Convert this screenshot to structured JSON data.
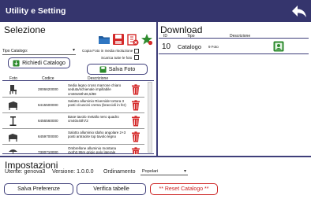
{
  "header": {
    "title": "Utility e Setting",
    "back_icon": "back-arrow-icon"
  },
  "colors": {
    "header_bg": "#35356d",
    "accent": "#3e3e7a",
    "danger": "#cc2222",
    "success": "#2e8b2e"
  },
  "selezione": {
    "title": "Selezione",
    "toolbar_icons": [
      "folder-icon",
      "save-icon",
      "delete-icon",
      "star-icon"
    ],
    "catalog_select": {
      "value": "Tipo Catalogo:"
    },
    "richiedi_label": "Richiedi Catalogo",
    "copia_label": "Copia Foto in media risoluzione",
    "scarica_label": "Scarica tutte le foto",
    "salva_foto_label": "Salva Foto",
    "table": {
      "columns": [
        "Foto",
        "Codice",
        "Descrizione"
      ],
      "rows": [
        {
          "code": "2806620000",
          "description": "Sedia legno cross marrone chiaro seduta/schienale impillabile cm50x50h46,5/88"
        },
        {
          "code": "6415500000",
          "description": "Salotto alluminio Riverside tortora 3 posti c/cuscini crema (braccioli in fer)"
        },
        {
          "code": "6456560000",
          "description": "Base tavolo metallo nero quadro cm40x40h72"
        },
        {
          "code": "6459700000",
          "description": "Salotto alluminio Idaho angolare 2+3 posti antracite top tavolo legno"
        },
        {
          "code": "7300710000",
          "description": "Ombrellone alluminio montana 4x4h2,95m grigio palo laterale"
        }
      ]
    }
  },
  "download": {
    "title": "Download",
    "columns": [
      "ID",
      "Tipo",
      "Descrizione"
    ],
    "rows": [
      {
        "id": "10",
        "tipo": "Catalogo",
        "description": "9 Foto",
        "icon": "download-icon"
      }
    ]
  },
  "impostazioni": {
    "title": "Impostazioni",
    "utente_label": "Utente: genova3",
    "versione_label": "Versione: 1.0.0.0",
    "ordinamento_label": "Ordinamento",
    "ordinamento_value": "Popolari",
    "salva_label": "Salva Preferenze",
    "verifica_label": "Verifica tabelle",
    "reset_label": "** Reset Catalogo **"
  }
}
